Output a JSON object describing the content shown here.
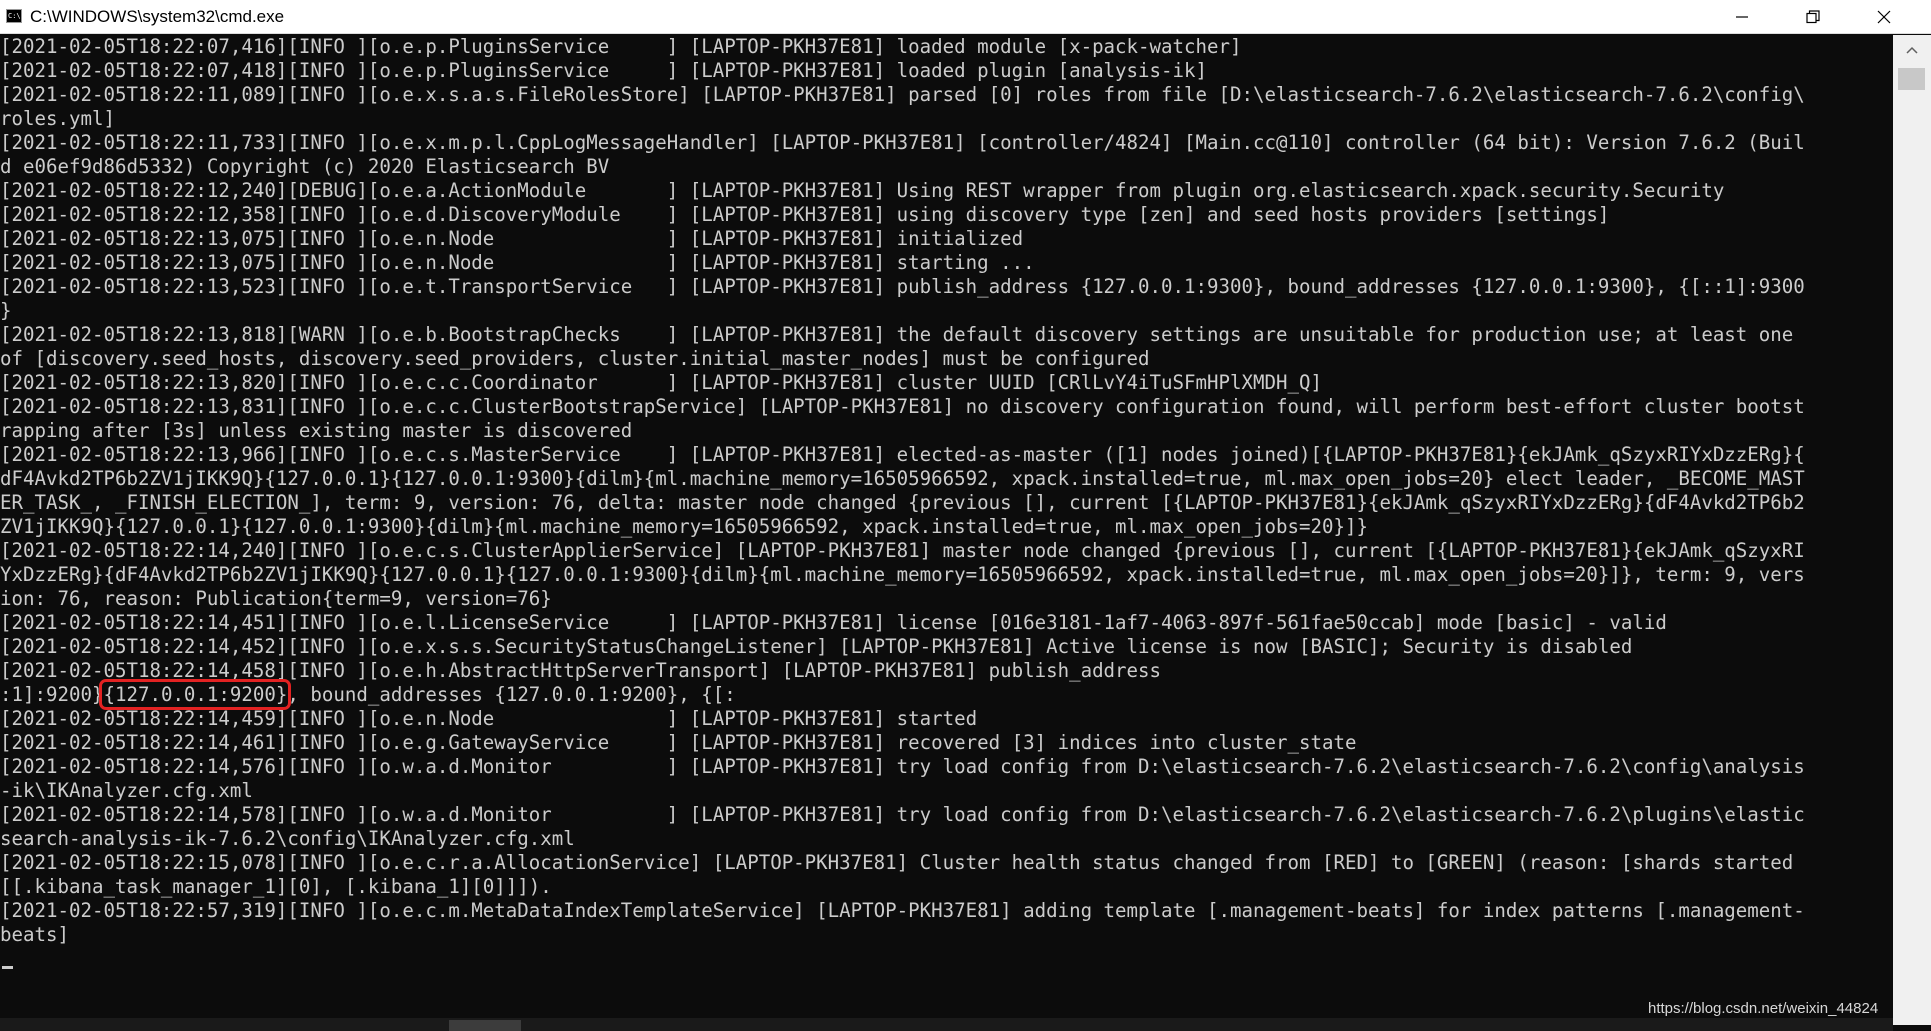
{
  "window": {
    "title": "C:\\WINDOWS\\system32\\cmd.exe",
    "icon": "cmd-icon",
    "controls": [
      "minimize-icon",
      "maximize-icon",
      "close-icon"
    ]
  },
  "console": {
    "lines": [
      "[2021-02-05T18:22:07,416][INFO ][o.e.p.PluginsService     ] [LAPTOP-PKH37E81] loaded module [x-pack-watcher]",
      "[2021-02-05T18:22:07,418][INFO ][o.e.p.PluginsService     ] [LAPTOP-PKH37E81] loaded plugin [analysis-ik]",
      "[2021-02-05T18:22:11,089][INFO ][o.e.x.s.a.s.FileRolesStore] [LAPTOP-PKH37E81] parsed [0] roles from file [D:\\elasticsearch-7.6.2\\elasticsearch-7.6.2\\config\\",
      "roles.yml]",
      "[2021-02-05T18:22:11,733][INFO ][o.e.x.m.p.l.CppLogMessageHandler] [LAPTOP-PKH37E81] [controller/4824] [Main.cc@110] controller (64 bit): Version 7.6.2 (Buil",
      "d e06ef9d86d5332) Copyright (c) 2020 Elasticsearch BV",
      "[2021-02-05T18:22:12,240][DEBUG][o.e.a.ActionModule       ] [LAPTOP-PKH37E81] Using REST wrapper from plugin org.elasticsearch.xpack.security.Security",
      "[2021-02-05T18:22:12,358][INFO ][o.e.d.DiscoveryModule    ] [LAPTOP-PKH37E81] using discovery type [zen] and seed hosts providers [settings]",
      "[2021-02-05T18:22:13,075][INFO ][o.e.n.Node               ] [LAPTOP-PKH37E81] initialized",
      "[2021-02-05T18:22:13,075][INFO ][o.e.n.Node               ] [LAPTOP-PKH37E81] starting ...",
      "[2021-02-05T18:22:13,523][INFO ][o.e.t.TransportService   ] [LAPTOP-PKH37E81] publish_address {127.0.0.1:9300}, bound_addresses {127.0.0.1:9300}, {[::1]:9300",
      "}",
      "[2021-02-05T18:22:13,818][WARN ][o.e.b.BootstrapChecks    ] [LAPTOP-PKH37E81] the default discovery settings are unsuitable for production use; at least one",
      "of [discovery.seed_hosts, discovery.seed_providers, cluster.initial_master_nodes] must be configured",
      "[2021-02-05T18:22:13,820][INFO ][o.e.c.c.Coordinator      ] [LAPTOP-PKH37E81] cluster UUID [CRlLvY4iTuSFmHPlXMDH_Q]",
      "[2021-02-05T18:22:13,831][INFO ][o.e.c.c.ClusterBootstrapService] [LAPTOP-PKH37E81] no discovery configuration found, will perform best-effort cluster bootst",
      "rapping after [3s] unless existing master is discovered",
      "[2021-02-05T18:22:13,966][INFO ][o.e.c.s.MasterService    ] [LAPTOP-PKH37E81] elected-as-master ([1] nodes joined)[{LAPTOP-PKH37E81}{ekJAmk_qSzyxRIYxDzzERg}{",
      "dF4Avkd2TP6b2ZV1jIKK9Q}{127.0.0.1}{127.0.0.1:9300}{dilm}{ml.machine_memory=16505966592, xpack.installed=true, ml.max_open_jobs=20} elect leader, _BECOME_MAST",
      "ER_TASK_, _FINISH_ELECTION_], term: 9, version: 76, delta: master node changed {previous [], current [{LAPTOP-PKH37E81}{ekJAmk_qSzyxRIYxDzzERg}{dF4Avkd2TP6b2",
      "ZV1jIKK9Q}{127.0.0.1}{127.0.0.1:9300}{dilm}{ml.machine_memory=16505966592, xpack.installed=true, ml.max_open_jobs=20}]}",
      "[2021-02-05T18:22:14,240][INFO ][o.e.c.s.ClusterApplierService] [LAPTOP-PKH37E81] master node changed {previous [], current [{LAPTOP-PKH37E81}{ekJAmk_qSzyxRI",
      "YxDzzERg}{dF4Avkd2TP6b2ZV1jIKK9Q}{127.0.0.1}{127.0.0.1:9300}{dilm}{ml.machine_memory=16505966592, xpack.installed=true, ml.max_open_jobs=20}]}, term: 9, vers",
      "ion: 76, reason: Publication{term=9, version=76}",
      "[2021-02-05T18:22:14,451][INFO ][o.e.l.LicenseService     ] [LAPTOP-PKH37E81] license [016e3181-1af7-4063-897f-561fae50ccab] mode [basic] - valid",
      "[2021-02-05T18:22:14,452][INFO ][o.e.x.s.s.SecurityStatusChangeListener] [LAPTOP-PKH37E81] Active license is now [BASIC]; Security is disabled",
      "[2021-02-05T18:22:14,458][INFO ][o.e.h.AbstractHttpServerTransport] [LAPTOP-PKH37E81] publish_address ",
      ":1]:9200}",
      "[2021-02-05T18:22:14,459][INFO ][o.e.n.Node               ] [LAPTOP-PKH37E81] started",
      "[2021-02-05T18:22:14,461][INFO ][o.e.g.GatewayService     ] [LAPTOP-PKH37E81] recovered [3] indices into cluster_state",
      "[2021-02-05T18:22:14,576][INFO ][o.w.a.d.Monitor          ] [LAPTOP-PKH37E81] try load config from D:\\elasticsearch-7.6.2\\elasticsearch-7.6.2\\config\\analysis",
      "-ik\\IKAnalyzer.cfg.xml",
      "[2021-02-05T18:22:14,578][INFO ][o.w.a.d.Monitor          ] [LAPTOP-PKH37E81] try load config from D:\\elasticsearch-7.6.2\\elasticsearch-7.6.2\\plugins\\elastic",
      "search-analysis-ik-7.6.2\\config\\IKAnalyzer.cfg.xml",
      "[2021-02-05T18:22:15,078][INFO ][o.e.c.r.a.AllocationService] [LAPTOP-PKH37E81] Cluster health status changed from [RED] to [GREEN] (reason: [shards started",
      "[[.kibana_task_manager_1][0], [.kibana_1][0]]]).",
      "[2021-02-05T18:22:57,319][INFO ][o.e.c.m.MetaDataIndexTemplateService] [LAPTOP-PKH37E81] adding template [.management-beats] for index patterns [.management-",
      "beats]"
    ],
    "highlight": {
      "text": "{127.0.0.1:9200}",
      "after": ", bound_addresses {127.0.0.1:9200}, {[:"
    }
  },
  "watermark": "https://blog.csdn.net/weixin_44824"
}
